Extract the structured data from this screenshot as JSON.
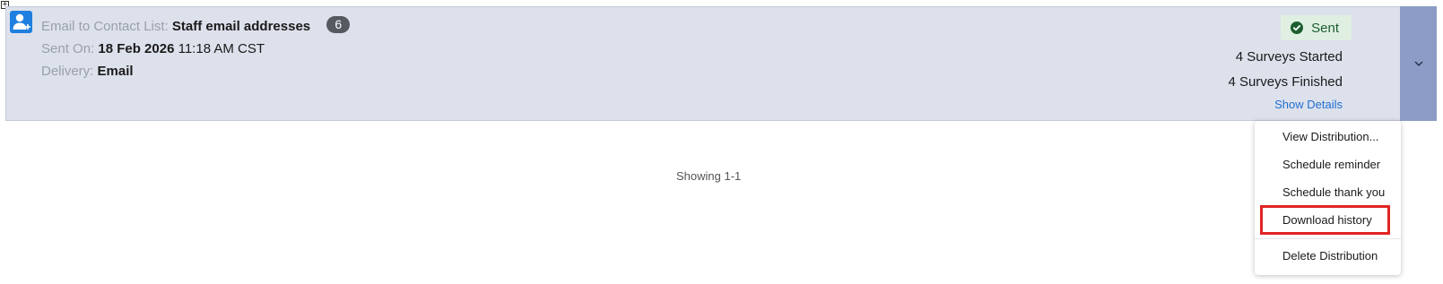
{
  "toggle": {
    "glyph": "+"
  },
  "distribution": {
    "type_label": "Email to Contact List:",
    "list_name": "Staff email addresses",
    "contact_count": "6",
    "sent_on_label": "Sent On:",
    "sent_date": "18 Feb 2026",
    "sent_time": "11:18 AM CST",
    "delivery_label": "Delivery:",
    "delivery_method": "Email",
    "status": "Sent",
    "surveys_started": "4 Surveys Started",
    "surveys_finished": "4 Surveys Finished",
    "show_details": "Show Details"
  },
  "pagination": {
    "text": "Showing 1-1"
  },
  "actions_menu": {
    "items": [
      {
        "label": "View Distribution..."
      },
      {
        "label": "Schedule reminder"
      },
      {
        "label": "Schedule thank you"
      },
      {
        "label": "Download history"
      },
      {
        "label": "Delete Distribution"
      }
    ]
  },
  "icons": {
    "contact": "add-contact-icon",
    "status": "check-circle-icon",
    "expand": "chevron-down-icon"
  },
  "colors": {
    "card_background": "#dde1ec",
    "accent_blue": "#1f7fe0",
    "link_blue": "#1f6fd1",
    "status_green": "#1c5e2f",
    "highlight_red": "#e02424"
  }
}
